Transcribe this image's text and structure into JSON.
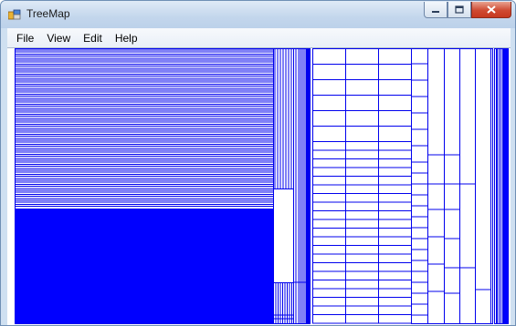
{
  "window": {
    "title": "TreeMap",
    "controls": {
      "minimize": "minimize",
      "maximize": "maximize",
      "close": "close"
    }
  },
  "menu": [
    {
      "label": "File"
    },
    {
      "label": "View"
    },
    {
      "label": "Edit"
    },
    {
      "label": "Help"
    }
  ],
  "treemap": {
    "stroke_color": "#0000ee",
    "fill_color": "#0000ff",
    "background": "#ffffff"
  },
  "icons": {
    "app": "treemap-app-icon",
    "minimize": "minimize-icon",
    "maximize": "maximize-icon",
    "close": "close-icon"
  }
}
